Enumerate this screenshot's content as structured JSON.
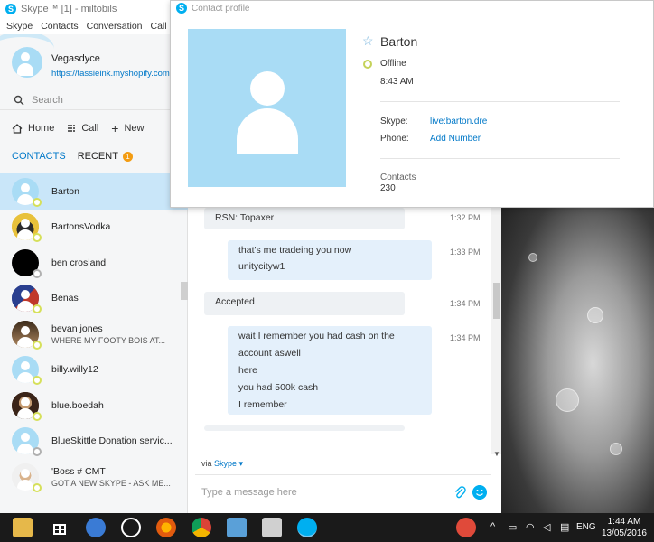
{
  "window": {
    "title": "Skype™ [1] - miltobils",
    "menu": [
      "Skype",
      "Contacts",
      "Conversation",
      "Call",
      "V"
    ]
  },
  "profile": {
    "name": "Vegasdyce",
    "mood": "https://tassieink.myshopify.com"
  },
  "search": {
    "label": "Search"
  },
  "nav": {
    "home": "Home",
    "call": "Call",
    "new": "New"
  },
  "tabs": {
    "contacts": "CONTACTS",
    "recent": "RECENT",
    "recent_badge": "1"
  },
  "contacts": [
    {
      "name": "Barton",
      "mood": "",
      "status": "away"
    },
    {
      "name": "BartonsVodka",
      "mood": "",
      "status": "away"
    },
    {
      "name": "ben crosland",
      "mood": "",
      "status": "offline"
    },
    {
      "name": "Benas",
      "mood": "",
      "status": "away"
    },
    {
      "name": "bevan jones",
      "mood": "WHERE MY FOOTY BOIS AT...",
      "status": "away"
    },
    {
      "name": "billy.willy12",
      "mood": "",
      "status": "away"
    },
    {
      "name": "blue.boedah",
      "mood": "",
      "status": "away"
    },
    {
      "name": "BlueSkittle Donation servic...",
      "mood": "",
      "status": "offline"
    },
    {
      "name": "'Boss # CMT",
      "mood": "GOT A NEW SKYPE - ASK ME...",
      "status": "away"
    }
  ],
  "messages": [
    {
      "text": [
        "RSN: Topaxer"
      ],
      "time": "1:32 PM",
      "side": "theirs"
    },
    {
      "text": [
        "that's me tradeing you now",
        "unitycityw1"
      ],
      "time": "1:33 PM",
      "side": "mine"
    },
    {
      "text": [
        "Accepted"
      ],
      "time": "1:34 PM",
      "side": "theirs"
    },
    {
      "text": [
        "wait I remember you had cash on the",
        "account aswell",
        "here",
        "you had 500k cash",
        "I remember"
      ],
      "time": "1:34 PM",
      "side": "mine"
    }
  ],
  "composer": {
    "via": "via",
    "via_link": "Skype ▾",
    "placeholder": "Type a message here"
  },
  "contact_profile": {
    "window_title": "Contact profile",
    "name": "Barton",
    "status": "Offline",
    "local_time": "8:43 AM",
    "skype_label": "Skype:",
    "skype_value": "live:barton.dre",
    "phone_label": "Phone:",
    "phone_value": "Add Number",
    "contacts_label": "Contacts",
    "contacts_count": "230"
  },
  "taskbar": {
    "time": "1:44 AM",
    "date": "13/05/2016",
    "lang": "ENG"
  },
  "colors": {
    "accent": "#00aff0",
    "link": "#0078c8",
    "selected_row": "#c9e6f9",
    "avatar_placeholder": "#a9dcf5"
  }
}
